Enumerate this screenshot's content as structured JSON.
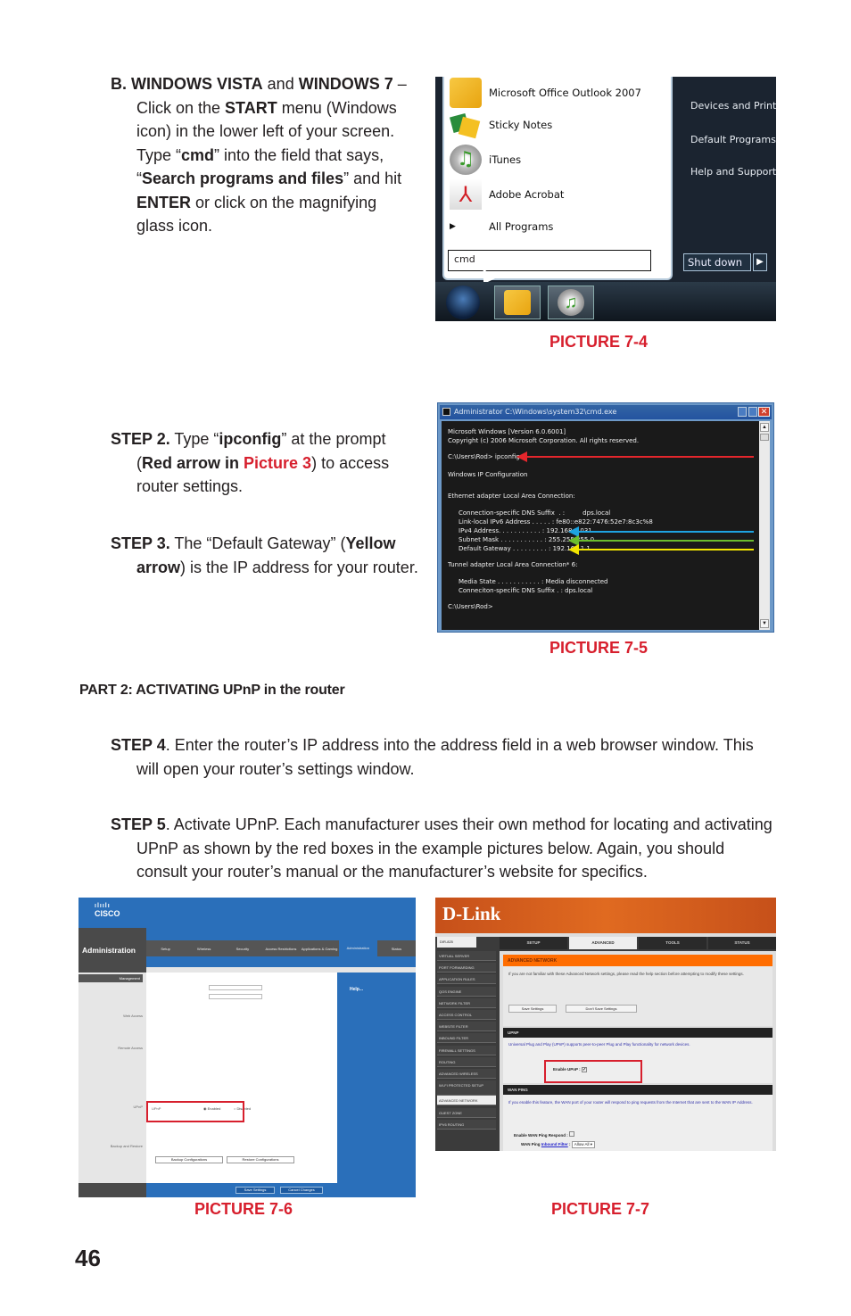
{
  "section_b": {
    "parts": [
      {
        "t": "B. WINDOWS VISTA",
        "b": true
      },
      {
        "t": " and ",
        "b": false
      },
      {
        "t": "WINDOWS 7",
        "b": true
      },
      {
        "t": " – Click on the ",
        "b": false
      },
      {
        "t": "START",
        "b": true
      },
      {
        "t": " menu (Windows icon) in the lower left of your screen. Type “",
        "b": false
      },
      {
        "t": "cmd",
        "b": true
      },
      {
        "t": "” into the field that says, “",
        "b": false
      },
      {
        "t": "Search programs and files",
        "b": true
      },
      {
        "t": "” and hit ",
        "b": false
      },
      {
        "t": "ENTER",
        "b": true
      },
      {
        "t": " or click on the magnifying glass icon.",
        "b": false
      }
    ]
  },
  "start_menu": {
    "programs": [
      "Microsoft Office Outlook 2007",
      "Sticky Notes",
      "iTunes",
      "Adobe Acrobat"
    ],
    "all_programs": "All Programs",
    "right_items": [
      "Devices and Printers",
      "Default Programs",
      "Help and Support"
    ],
    "search_value": "cmd",
    "shutdown_label": "Shut down"
  },
  "captions": {
    "pic4": "PICTURE 7-4",
    "pic5": "PICTURE 7-5",
    "pic6": "PICTURE 7-6",
    "pic7": "PICTURE 7-7"
  },
  "step2": {
    "label": "STEP 2.",
    "t1": " Type “",
    "cmd": "ipconfig",
    "t2": "” at the prompt (",
    "red_bold": "Red arrow in ",
    "pic_ref": "Picture 3",
    "t3": ") to access router settings."
  },
  "step3": {
    "label": "STEP 3.",
    "t1": " The “Default Gateway” (",
    "yellow": "Yellow arrow",
    "t2": ") is the IP address for your router."
  },
  "cmd_window": {
    "title": "Administrator C:\\Windows\\system32\\cmd.exe",
    "lines": [
      "Microsoft Windows [Version 6.0.6001]",
      "Copyright (c) 2006 Microsoft Corporation. All rights reserved.",
      "C:\\Users\\Rod> ipconfig",
      "Windows IP Configuration",
      "Ethernet adapter Local Area Connection:",
      "Connection-specific DNS Suffix  . :         dps.local",
      "Link-local IPv6 Address . . . . . : fe80::e822:7476:52e7:8c3c%8",
      "IPv4 Address. . . . . . . . . . . : 192.168.1.031",
      "Subnet Mask . . . . . . . . . . . : 255.255.255.0",
      "Default Gateway . . . . . . . . . : 192.168.1.1",
      "Tunnel adapter Local Area Connection* 6:",
      "Media State . . . . . . . . . . . : Media disconnected",
      "Conneciton-specific DNS Suffix . : dps.local",
      "C:\\Users\\Rod>"
    ],
    "arrow_colors": {
      "red": "#e5262c",
      "blue": "#1ea3e0",
      "green": "#6cbd2e",
      "yellow": "#f3e600"
    }
  },
  "part2": {
    "heading": "PART 2: ACTIVATING UPnP in the router"
  },
  "step4": {
    "label": "STEP 4",
    "text": ". Enter the router’s IP address into the address field in a web browser window. This will open your router’s settings window."
  },
  "step5": {
    "label": "STEP 5",
    "text": ". Activate UPnP. Each manufacturer uses their own method for locating and activating UPnP as shown by the red boxes in the example pictures below. Again, you should consult your router’s manual or the manufacturer’s website for specifics."
  },
  "cisco": {
    "brand": "CISCO",
    "section": "Administration",
    "tabs": [
      "Setup",
      "Wireless",
      "Security",
      "Access Restrictions",
      "Applications & Gaming",
      "Administration",
      "Status"
    ],
    "sidebar": [
      "Management",
      "Web Access",
      "Remote Access",
      "UPnP",
      "Backup and Restore"
    ],
    "upnp_label": "UPnP",
    "upnp_options": [
      "Enabled",
      "Disabled"
    ],
    "buttons": [
      "Backup Configurations",
      "Restore Configurations"
    ],
    "footer_buttons": [
      "Save Settings",
      "Cancel Changes"
    ],
    "help": "Help..."
  },
  "dlink": {
    "brand": "D-Link",
    "model": "DIR-825",
    "tabs": [
      "SETUP",
      "ADVANCED",
      "TOOLS",
      "STATUS"
    ],
    "sidebar": [
      "VIRTUAL SERVER",
      "PORT FORWARDING",
      "APPLICATION RULES",
      "QOS ENGINE",
      "NETWORK FILTER",
      "ACCESS CONTROL",
      "WEBSITE FILTER",
      "INBOUND FILTER",
      "FIREWALL SETTINGS",
      "ROUTING",
      "ADVANCED WIRELESS",
      "WI-FI PROTECTED SETUP",
      "ADVANCED NETWORK",
      "GUEST ZONE",
      "IPV6 ROUTING"
    ],
    "panel_title": "ADVANCED NETWORK",
    "intro": "If you are not familiar with these Advanced Network settings, please read the help section before attempting to modify these settings.",
    "save_btn": "Save Settings",
    "dont_save_btn": "Don't Save Settings",
    "upnp_title": "UPNP",
    "upnp_desc": "Universal Plug and Play (UPnP) supports peer-to-peer Plug and Play functionality for network devices.",
    "enable_upnp": "Enable UPnP :",
    "wan_title": "WAN PING",
    "wan_desc": "If you enable this feature, the WAN port of your router will respond to ping requests from the Internet that are sent to the WAN IP Address.",
    "wan_respond": "Enable WAN Ping Respond :",
    "wan_ping": "WAN Ping",
    "inbound_filter": "Inbound Filter",
    "allow_all": "Allow All"
  },
  "page_number": "46"
}
